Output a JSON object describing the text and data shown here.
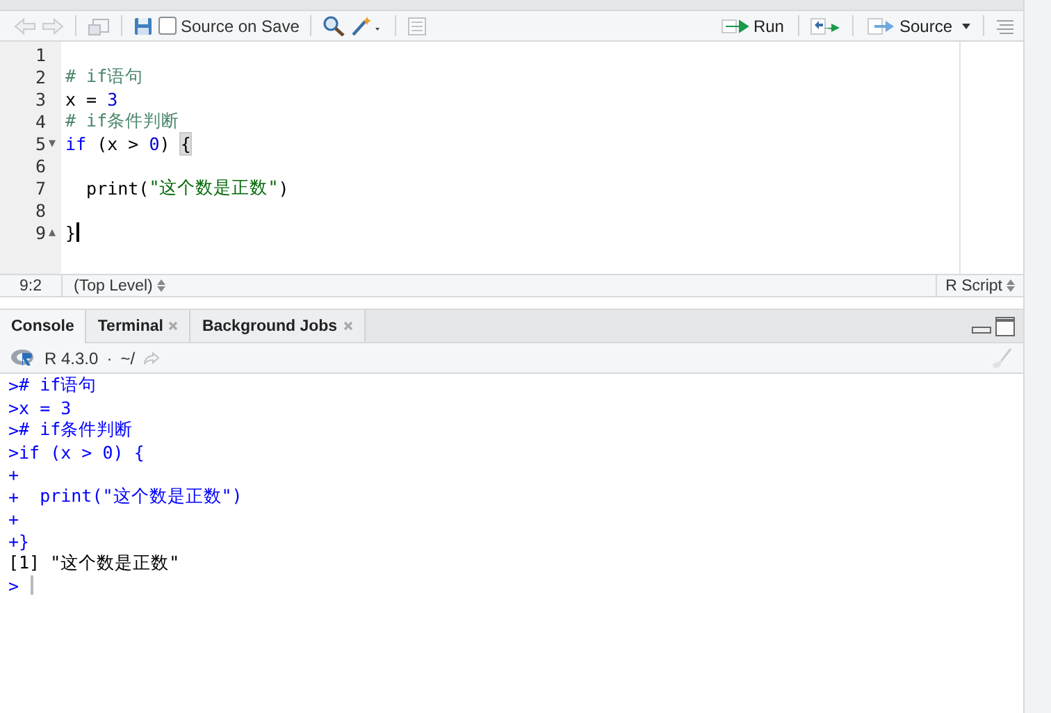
{
  "editor": {
    "toolbar": {
      "source_on_save": {
        "label": "Source on Save",
        "checked": false
      },
      "run": "Run",
      "source": "Source"
    },
    "lines": [
      {
        "number": "1",
        "cursor": false
      },
      {
        "number": "2",
        "cursor": false,
        "tokens": [
          {
            "kind": "comment",
            "text": "# if语句"
          }
        ]
      },
      {
        "number": "3",
        "cursor": false,
        "tokens": [
          {
            "kind": "plain",
            "text": "x = "
          },
          {
            "kind": "number",
            "text": "3"
          }
        ]
      },
      {
        "number": "4",
        "cursor": false,
        "tokens": [
          {
            "kind": "comment",
            "text": "# if条件判断"
          }
        ]
      },
      {
        "number": "5",
        "cursor": false,
        "fold": "▾",
        "tokens": [
          {
            "kind": "keyword",
            "text": "if"
          },
          {
            "kind": "plain",
            "text": " (x > "
          },
          {
            "kind": "number",
            "text": "0"
          },
          {
            "kind": "plain",
            "text": ") "
          },
          {
            "kind": "brace",
            "text": "{"
          }
        ]
      },
      {
        "number": "6",
        "cursor": false
      },
      {
        "number": "7",
        "cursor": false,
        "tokens": [
          {
            "kind": "plain",
            "text": "  print("
          },
          {
            "kind": "string",
            "text": "\"这个数是正数\""
          },
          {
            "kind": "plain",
            "text": ")"
          }
        ]
      },
      {
        "number": "8",
        "cursor": false
      },
      {
        "number": "9",
        "cursor": true,
        "fold": "▴",
        "tokens": [
          {
            "kind": "plain",
            "text": "}"
          }
        ]
      }
    ],
    "status_bar": {
      "position": "9:2",
      "scope": "(Top Level)",
      "file_type": "R Script"
    }
  },
  "console": {
    "tabs": [
      {
        "label": "Console",
        "selected": true,
        "closable": false
      },
      {
        "label": "Terminal",
        "selected": false,
        "closable": true
      },
      {
        "label": "Background Jobs",
        "selected": false,
        "closable": true
      }
    ],
    "version": "R 4.3.0",
    "separator": "·",
    "path": "~/",
    "lines": [
      {
        "kind": "input",
        "prompt": ">",
        "text": "# if语句",
        "cursor": false
      },
      {
        "kind": "input",
        "prompt": ">",
        "text": "x = 3",
        "cursor": false
      },
      {
        "kind": "input",
        "prompt": ">",
        "text": "# if条件判断",
        "cursor": false
      },
      {
        "kind": "input",
        "prompt": ">",
        "text": "if (x > 0) {",
        "cursor": false
      },
      {
        "kind": "input",
        "prompt": "+",
        "cursor": false
      },
      {
        "kind": "input",
        "prompt": "+",
        "text": "  print(\"这个数是正数\")",
        "cursor": false
      },
      {
        "kind": "input",
        "prompt": "+",
        "cursor": false
      },
      {
        "kind": "input",
        "prompt": "+",
        "text": "}",
        "cursor": false
      },
      {
        "kind": "output",
        "text": "[1] \"这个数是正数\"",
        "cursor": false
      },
      {
        "kind": "input",
        "prompt": ">",
        "cursor": true
      }
    ]
  }
}
